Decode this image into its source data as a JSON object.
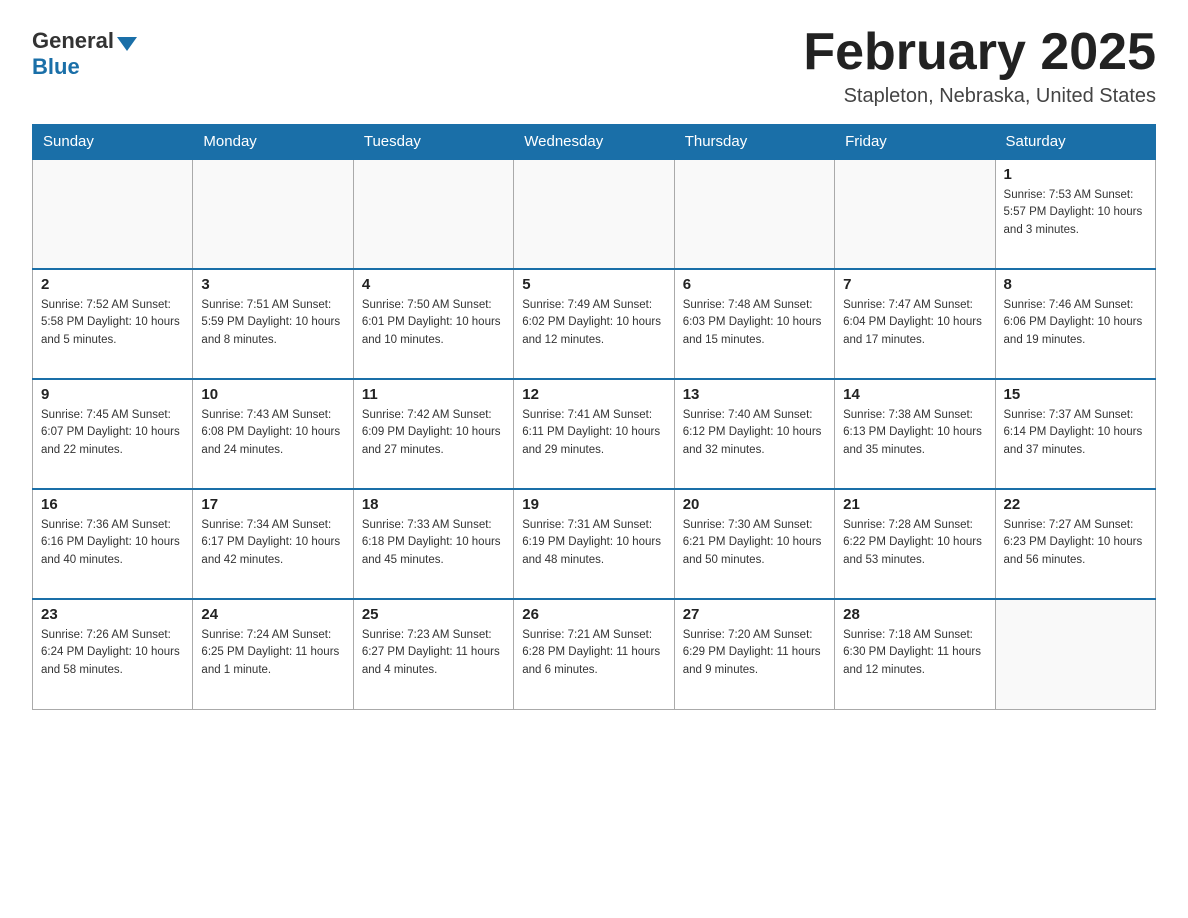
{
  "logo": {
    "text_general": "General",
    "text_blue": "Blue"
  },
  "title": "February 2025",
  "subtitle": "Stapleton, Nebraska, United States",
  "days_of_week": [
    "Sunday",
    "Monday",
    "Tuesday",
    "Wednesday",
    "Thursday",
    "Friday",
    "Saturday"
  ],
  "weeks": [
    [
      {
        "day": "",
        "info": ""
      },
      {
        "day": "",
        "info": ""
      },
      {
        "day": "",
        "info": ""
      },
      {
        "day": "",
        "info": ""
      },
      {
        "day": "",
        "info": ""
      },
      {
        "day": "",
        "info": ""
      },
      {
        "day": "1",
        "info": "Sunrise: 7:53 AM\nSunset: 5:57 PM\nDaylight: 10 hours and 3 minutes."
      }
    ],
    [
      {
        "day": "2",
        "info": "Sunrise: 7:52 AM\nSunset: 5:58 PM\nDaylight: 10 hours and 5 minutes."
      },
      {
        "day": "3",
        "info": "Sunrise: 7:51 AM\nSunset: 5:59 PM\nDaylight: 10 hours and 8 minutes."
      },
      {
        "day": "4",
        "info": "Sunrise: 7:50 AM\nSunset: 6:01 PM\nDaylight: 10 hours and 10 minutes."
      },
      {
        "day": "5",
        "info": "Sunrise: 7:49 AM\nSunset: 6:02 PM\nDaylight: 10 hours and 12 minutes."
      },
      {
        "day": "6",
        "info": "Sunrise: 7:48 AM\nSunset: 6:03 PM\nDaylight: 10 hours and 15 minutes."
      },
      {
        "day": "7",
        "info": "Sunrise: 7:47 AM\nSunset: 6:04 PM\nDaylight: 10 hours and 17 minutes."
      },
      {
        "day": "8",
        "info": "Sunrise: 7:46 AM\nSunset: 6:06 PM\nDaylight: 10 hours and 19 minutes."
      }
    ],
    [
      {
        "day": "9",
        "info": "Sunrise: 7:45 AM\nSunset: 6:07 PM\nDaylight: 10 hours and 22 minutes."
      },
      {
        "day": "10",
        "info": "Sunrise: 7:43 AM\nSunset: 6:08 PM\nDaylight: 10 hours and 24 minutes."
      },
      {
        "day": "11",
        "info": "Sunrise: 7:42 AM\nSunset: 6:09 PM\nDaylight: 10 hours and 27 minutes."
      },
      {
        "day": "12",
        "info": "Sunrise: 7:41 AM\nSunset: 6:11 PM\nDaylight: 10 hours and 29 minutes."
      },
      {
        "day": "13",
        "info": "Sunrise: 7:40 AM\nSunset: 6:12 PM\nDaylight: 10 hours and 32 minutes."
      },
      {
        "day": "14",
        "info": "Sunrise: 7:38 AM\nSunset: 6:13 PM\nDaylight: 10 hours and 35 minutes."
      },
      {
        "day": "15",
        "info": "Sunrise: 7:37 AM\nSunset: 6:14 PM\nDaylight: 10 hours and 37 minutes."
      }
    ],
    [
      {
        "day": "16",
        "info": "Sunrise: 7:36 AM\nSunset: 6:16 PM\nDaylight: 10 hours and 40 minutes."
      },
      {
        "day": "17",
        "info": "Sunrise: 7:34 AM\nSunset: 6:17 PM\nDaylight: 10 hours and 42 minutes."
      },
      {
        "day": "18",
        "info": "Sunrise: 7:33 AM\nSunset: 6:18 PM\nDaylight: 10 hours and 45 minutes."
      },
      {
        "day": "19",
        "info": "Sunrise: 7:31 AM\nSunset: 6:19 PM\nDaylight: 10 hours and 48 minutes."
      },
      {
        "day": "20",
        "info": "Sunrise: 7:30 AM\nSunset: 6:21 PM\nDaylight: 10 hours and 50 minutes."
      },
      {
        "day": "21",
        "info": "Sunrise: 7:28 AM\nSunset: 6:22 PM\nDaylight: 10 hours and 53 minutes."
      },
      {
        "day": "22",
        "info": "Sunrise: 7:27 AM\nSunset: 6:23 PM\nDaylight: 10 hours and 56 minutes."
      }
    ],
    [
      {
        "day": "23",
        "info": "Sunrise: 7:26 AM\nSunset: 6:24 PM\nDaylight: 10 hours and 58 minutes."
      },
      {
        "day": "24",
        "info": "Sunrise: 7:24 AM\nSunset: 6:25 PM\nDaylight: 11 hours and 1 minute."
      },
      {
        "day": "25",
        "info": "Sunrise: 7:23 AM\nSunset: 6:27 PM\nDaylight: 11 hours and 4 minutes."
      },
      {
        "day": "26",
        "info": "Sunrise: 7:21 AM\nSunset: 6:28 PM\nDaylight: 11 hours and 6 minutes."
      },
      {
        "day": "27",
        "info": "Sunrise: 7:20 AM\nSunset: 6:29 PM\nDaylight: 11 hours and 9 minutes."
      },
      {
        "day": "28",
        "info": "Sunrise: 7:18 AM\nSunset: 6:30 PM\nDaylight: 11 hours and 12 minutes."
      },
      {
        "day": "",
        "info": ""
      }
    ]
  ]
}
